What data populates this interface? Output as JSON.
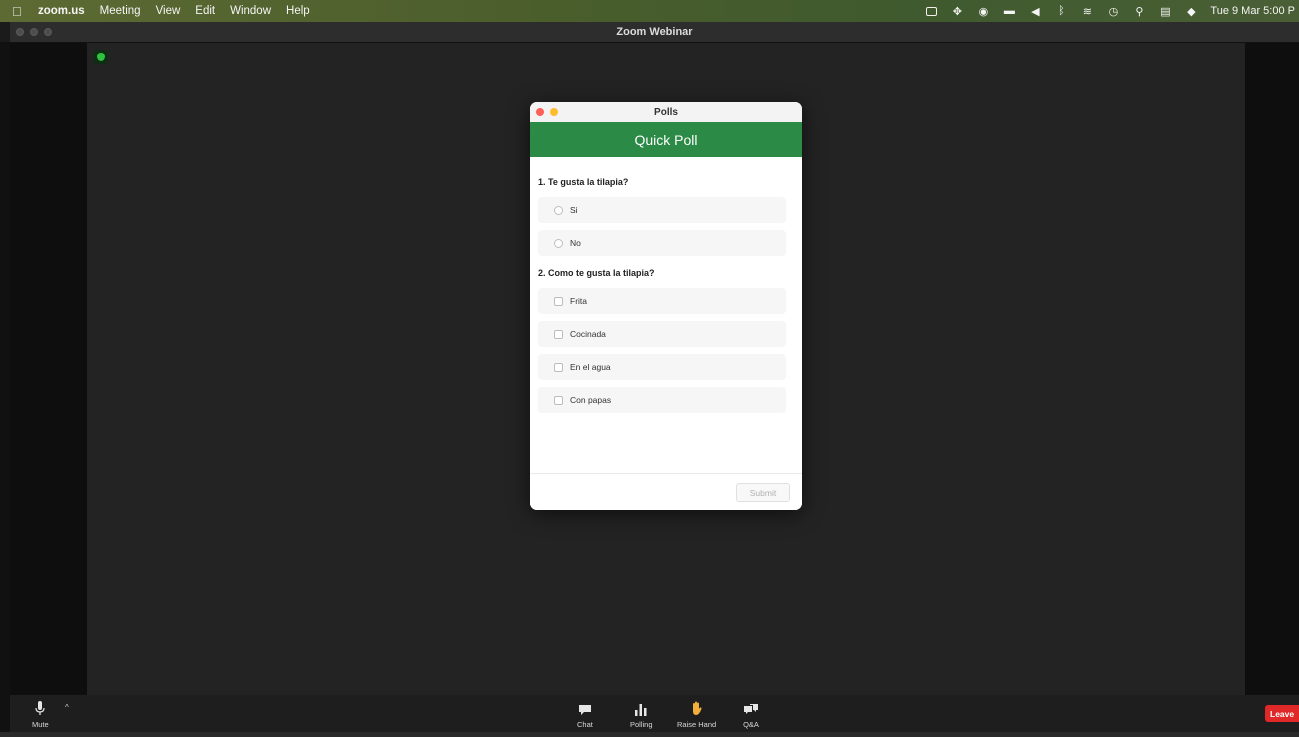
{
  "menubar": {
    "app": "zoom.us",
    "items": [
      "Meeting",
      "View",
      "Edit",
      "Window",
      "Help"
    ],
    "status_icons": [
      "screen-record-icon",
      "dropbox-icon",
      "app-icon",
      "message-icon",
      "volume-icon",
      "bluetooth-icon",
      "wifi-icon",
      "clock-icon",
      "search-icon",
      "control-center-icon",
      "siri-icon"
    ],
    "clock": "Tue 9 Mar  5:00 P"
  },
  "window": {
    "title": "Zoom Webinar"
  },
  "poll_dialog": {
    "window_title": "Polls",
    "header": "Quick Poll",
    "questions": [
      {
        "text": "1. Te gusta la tilapia?",
        "type": "single",
        "options": [
          "Si",
          "No"
        ]
      },
      {
        "text": "2. Como te gusta la tilapia?",
        "type": "multiple",
        "options": [
          "Frita",
          "Cocinada",
          "En el agua",
          "Con papas"
        ]
      }
    ],
    "submit_label": "Submit"
  },
  "toolbar": {
    "mute_label": "Mute",
    "chat_label": "Chat",
    "polling_label": "Polling",
    "raise_hand_label": "Raise Hand",
    "qa_label": "Q&A",
    "leave_label": "Leave"
  },
  "colors": {
    "poll_header": "#2b8a45",
    "leave": "#e02828",
    "raise_hand": "#f2b03a"
  }
}
